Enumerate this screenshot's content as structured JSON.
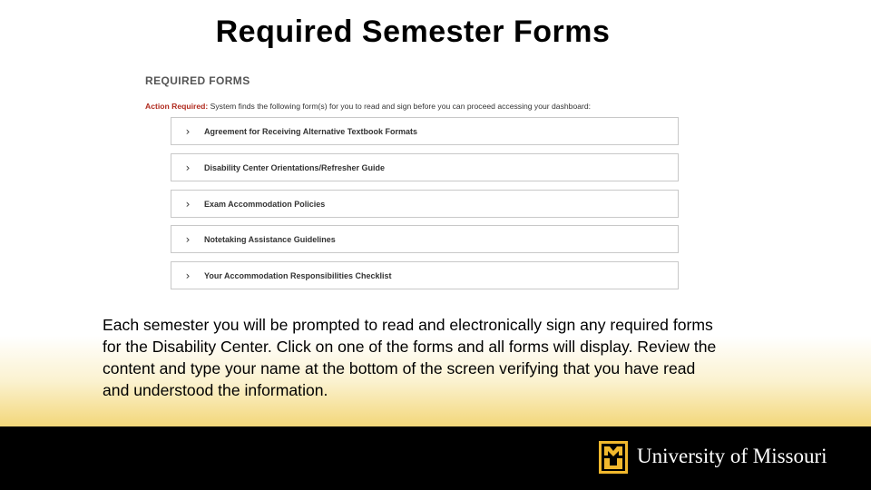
{
  "slide": {
    "title": "Required Semester Forms",
    "description": "Each semester you will be prompted to read and electronically sign any required forms for the Disability Center. Click on one of the forms and all forms will display. Review the content and type your name at the bottom of the screen verifying that you have read and understood the information."
  },
  "screenshot": {
    "heading": "REQUIRED FORMS",
    "action_label": "Action Required:",
    "action_text": " System finds the following form(s) for you to read and sign before you can proceed accessing your dashboard:",
    "forms": [
      {
        "label": "Agreement for Receiving Alternative Textbook Formats",
        "icon": "chevron-right-icon"
      },
      {
        "label": "Disability Center Orientations/Refresher Guide",
        "icon": "chevron-right-icon"
      },
      {
        "label": "Exam Accommodation Policies",
        "icon": "chevron-right-icon"
      },
      {
        "label": "Notetaking Assistance Guidelines",
        "icon": "chevron-right-icon"
      },
      {
        "label": "Your Accommodation Responsibilities Checklist",
        "icon": "chevron-right-icon"
      }
    ],
    "chevron_glyph": "›",
    "action_color": "#b02a1e"
  },
  "footer": {
    "wordmark": "University of Missouri",
    "logo_icon": "mu-logo-icon",
    "logo_letters": "MU",
    "colors": {
      "gold": "#f1b82d",
      "black": "#000000"
    }
  }
}
